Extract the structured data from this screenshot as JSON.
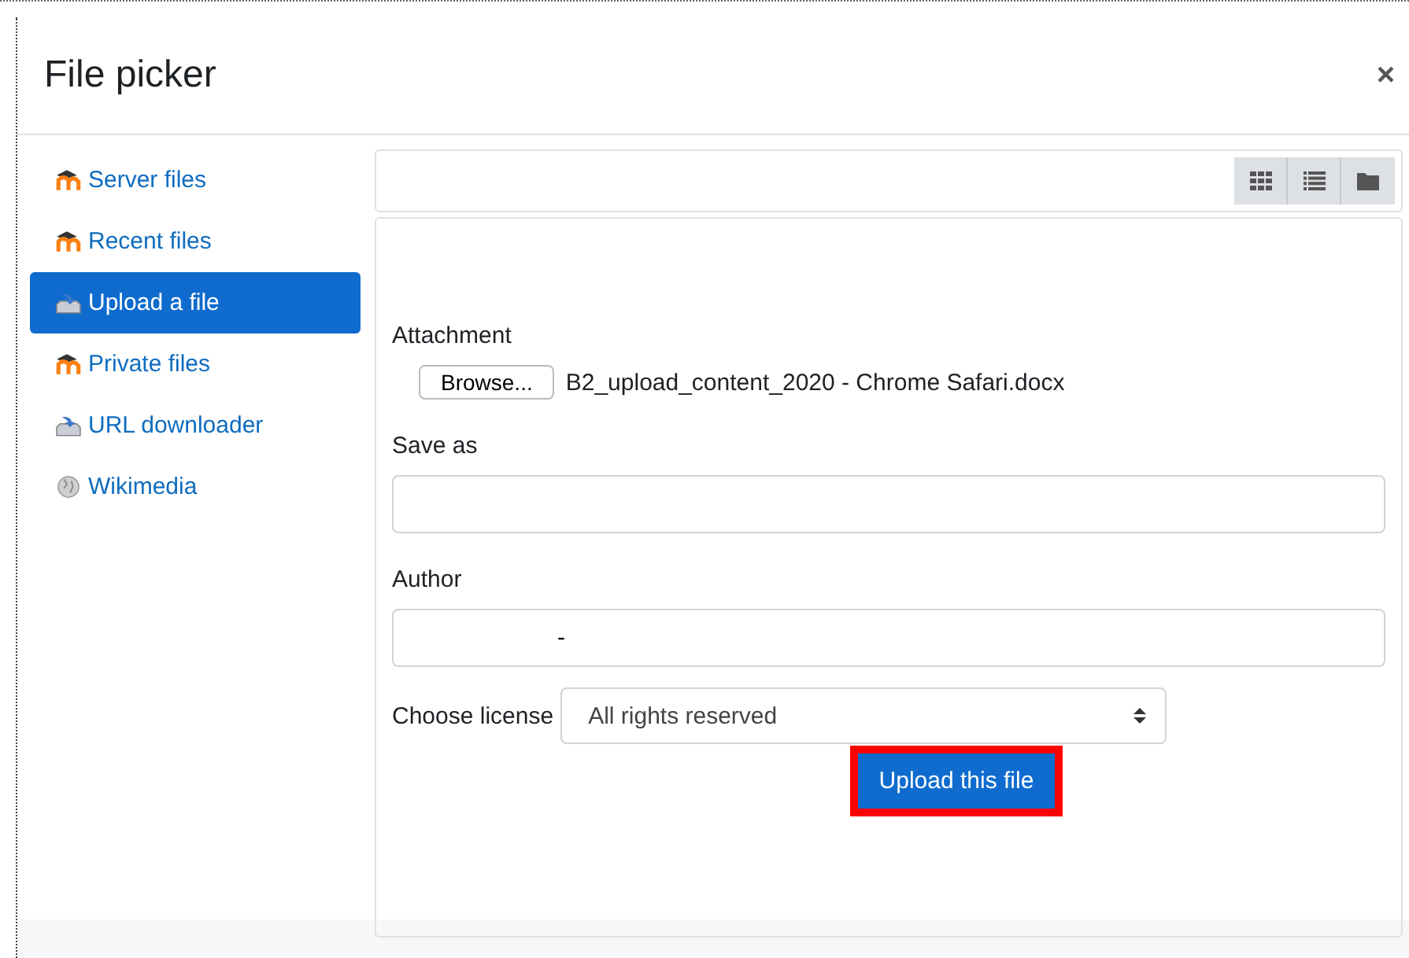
{
  "dialog": {
    "title": "File picker",
    "close": "×"
  },
  "sidebar": {
    "items": [
      {
        "label": "Server files",
        "kind": "moodle",
        "selected": false
      },
      {
        "label": "Recent files",
        "kind": "moodle",
        "selected": false
      },
      {
        "label": "Upload a file",
        "kind": "upload",
        "selected": true
      },
      {
        "label": "Private files",
        "kind": "moodle",
        "selected": false
      },
      {
        "label": "URL downloader",
        "kind": "upload",
        "selected": false
      },
      {
        "label": "Wikimedia",
        "kind": "globe",
        "selected": false
      }
    ]
  },
  "form": {
    "attachment": {
      "label": "Attachment",
      "button": "Browse...",
      "filename": "B2_upload_content_2020 - Chrome Safari.docx"
    },
    "save_as": {
      "label": "Save as"
    },
    "author": {
      "label": "Author",
      "value": "-"
    },
    "license": {
      "label": "Choose license",
      "value": "All rights reserved"
    },
    "submit": {
      "label": "Upload this file",
      "highlighted": true
    }
  }
}
